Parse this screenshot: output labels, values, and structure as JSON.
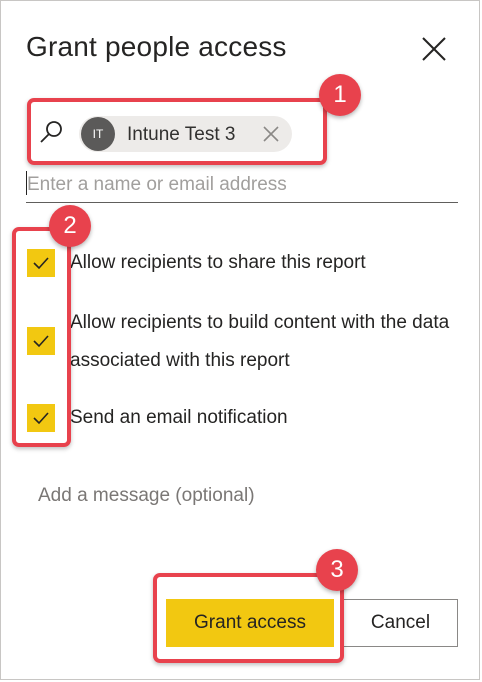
{
  "dialog": {
    "title": "Grant people access",
    "close_icon": "close-icon"
  },
  "recipients": {
    "search_icon": "search-icon",
    "chip": {
      "initials": "IT",
      "name": "Intune Test 3",
      "remove_icon": "close-icon"
    },
    "input_placeholder": "Enter a name or email address",
    "input_value": ""
  },
  "options": [
    {
      "label": "Allow recipients to share this report",
      "checked": true
    },
    {
      "label": "Allow recipients to build content with the data associated with this report",
      "checked": true
    },
    {
      "label": "Send an email notification",
      "checked": true
    }
  ],
  "message": {
    "placeholder": "Add a message (optional)",
    "value": ""
  },
  "actions": {
    "grant_label": "Grant access",
    "cancel_label": "Cancel"
  },
  "annotations": {
    "badge_1": "1",
    "badge_2": "2",
    "badge_3": "3"
  },
  "colors": {
    "accent": "#f2c811",
    "annotation": "#e8424d",
    "avatar": "#5b5a59",
    "chip": "#edebe9"
  }
}
